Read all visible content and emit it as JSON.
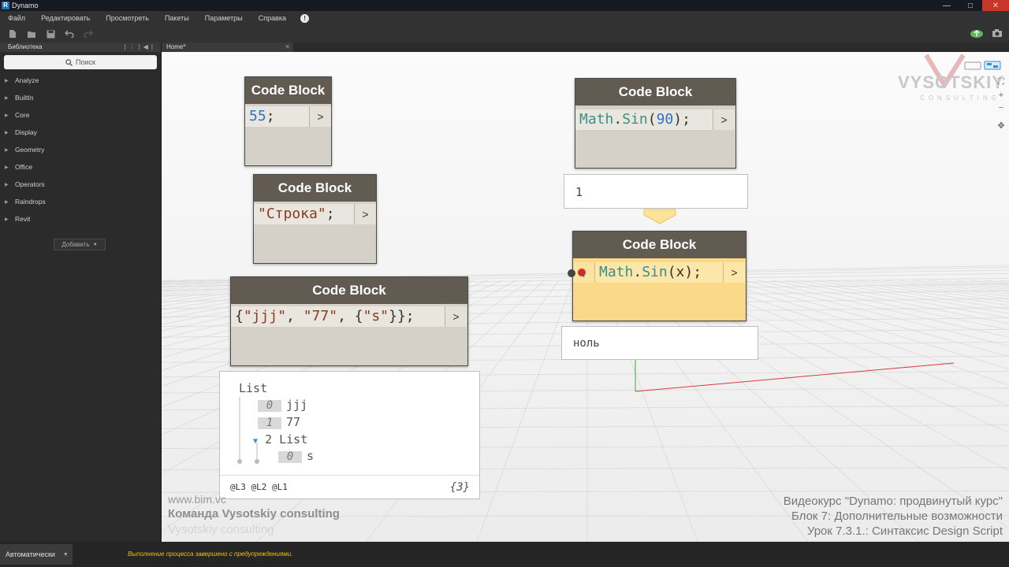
{
  "titlebar": {
    "title": "Dynamo",
    "app_letter": "R"
  },
  "menu": {
    "items": [
      "Файл",
      "Редактировать",
      "Просмотреть",
      "Пакеты",
      "Параметры",
      "Справка"
    ],
    "help_symbol": "!"
  },
  "library": {
    "header": "Библиотека",
    "search_placeholder": "Поиск",
    "categories": [
      "Analyze",
      "BuiltIn",
      "Core",
      "Display",
      "Geometry",
      "Office",
      "Operators",
      "Raindrops",
      "Revit"
    ],
    "add_button": "Добавить"
  },
  "tabs": [
    {
      "label": "Home*"
    }
  ],
  "nodes": [
    {
      "id": "cb1",
      "title": "Code Block",
      "code_tokens": [
        {
          "t": "55",
          "c": "num"
        },
        {
          "t": ";",
          "c": "kw"
        }
      ],
      "port": ">"
    },
    {
      "id": "cb2",
      "title": "Code Block",
      "code_tokens": [
        {
          "t": "\"Строка\"",
          "c": "str"
        },
        {
          "t": ";",
          "c": "kw"
        }
      ],
      "port": ">"
    },
    {
      "id": "cb3",
      "title": "Code Block",
      "code_tokens": [
        {
          "t": "{",
          "c": "kw"
        },
        {
          "t": "\"jjj\"",
          "c": "str"
        },
        {
          "t": ", ",
          "c": "kw"
        },
        {
          "t": "\"77\"",
          "c": "str"
        },
        {
          "t": ", {",
          "c": "kw"
        },
        {
          "t": "\"s\"",
          "c": "str"
        },
        {
          "t": "}};",
          "c": "kw"
        }
      ],
      "port": ">"
    },
    {
      "id": "cb4",
      "title": "Code Block",
      "code_tokens": [
        {
          "t": "Math",
          "c": "fn"
        },
        {
          "t": ".",
          "c": "kw"
        },
        {
          "t": "Sin",
          "c": "fn"
        },
        {
          "t": "(",
          "c": "kw"
        },
        {
          "t": "90",
          "c": "num"
        },
        {
          "t": ");",
          "c": "kw"
        }
      ],
      "port": ">"
    },
    {
      "id": "cb5",
      "title": "Code Block",
      "code_tokens": [
        {
          "t": "Math",
          "c": "fn"
        },
        {
          "t": ".",
          "c": "kw"
        },
        {
          "t": "Sin",
          "c": "fn"
        },
        {
          "t": "(x);",
          "c": "kw"
        }
      ],
      "port": ">",
      "input_port": "x",
      "state": "warning"
    }
  ],
  "previews": {
    "sin90": "1",
    "sinx": "ноль",
    "list": {
      "header": "List",
      "items": [
        {
          "index": "0",
          "value": "jjj"
        },
        {
          "index": "1",
          "value": "77"
        }
      ],
      "nested": {
        "index": "2",
        "label": "List",
        "items": [
          {
            "index": "0",
            "value": "s"
          }
        ]
      },
      "levels": [
        "@L3",
        "@L2",
        "@L1"
      ],
      "count": "{3}"
    }
  },
  "watermark": {
    "url": "www.bim.vc",
    "team": "Команда Vysotskiy consulting",
    "team_faded": "Vysotskiy consulting",
    "logo_main": "VYSOTSKIY",
    "logo_sub": "CONSULTING",
    "course": [
      "Видеокурс \"Dynamo: продвинутый курс\"",
      "Блок 7: Дополнительные возможности",
      "Урок 7.3.1.: Синтаксис Design Script"
    ]
  },
  "status": {
    "run_mode": "Автоматически",
    "message": "Выполнение процесса завершено с предупреждениями."
  },
  "colors": {
    "node_header": "#625b51",
    "node_body": "#d5d1c8",
    "warning_body": "#fbd98a",
    "status_message": "#f0c000",
    "grid_x_axis": "#d63a3a",
    "grid_y_axis": "#3aa83a"
  }
}
